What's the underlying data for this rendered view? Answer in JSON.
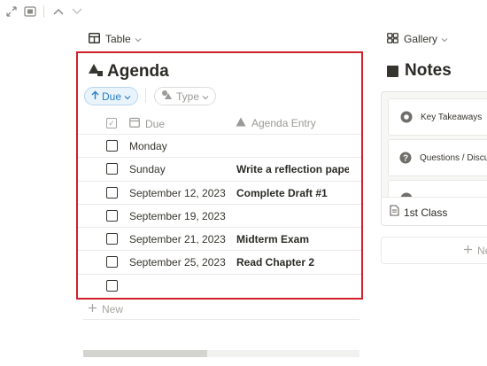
{
  "topbar": {
    "icons": [
      "expand-icon",
      "peek-mode-icon",
      "chevron-up-icon",
      "chevron-down-icon"
    ]
  },
  "left_view": {
    "tab_label": "Table"
  },
  "agenda": {
    "title": "Agenda",
    "filters": {
      "sort_label": "Due",
      "type_label": "Type"
    },
    "columns": {
      "due": "Due",
      "entry": "Agenda Entry"
    },
    "rows": [
      {
        "due": "Monday",
        "entry": "",
        "checked": false
      },
      {
        "due": "Sunday",
        "entry": "Write a reflection paper about",
        "checked": false
      },
      {
        "due": "September 12, 2023",
        "entry": "Complete Draft #1",
        "checked": false
      },
      {
        "due": "September 19, 2023",
        "entry": "",
        "checked": false
      },
      {
        "due": "September 21, 2023",
        "entry": "Midterm Exam",
        "checked": false
      },
      {
        "due": "September 25, 2023",
        "entry": "Read Chapter 2",
        "checked": false
      },
      {
        "due": "",
        "entry": "",
        "checked": false
      }
    ],
    "new_label": "New",
    "scroll_fraction": 0.45
  },
  "right_view": {
    "tab_label": "Gallery",
    "title": "Notes",
    "gallery_items": [
      {
        "label": "Key Takeaways",
        "icon": "target-icon"
      },
      {
        "label": "Questions / Discussion",
        "icon": "question-circle-icon"
      },
      {
        "label": "",
        "icon": "item-icon"
      }
    ],
    "card_title": "1st Class",
    "new_label": "New"
  },
  "colors": {
    "highlight_border": "#d0202c",
    "sort_accent": "#2a7fc9",
    "text": "#37352f",
    "muted": "#9b9a97"
  }
}
